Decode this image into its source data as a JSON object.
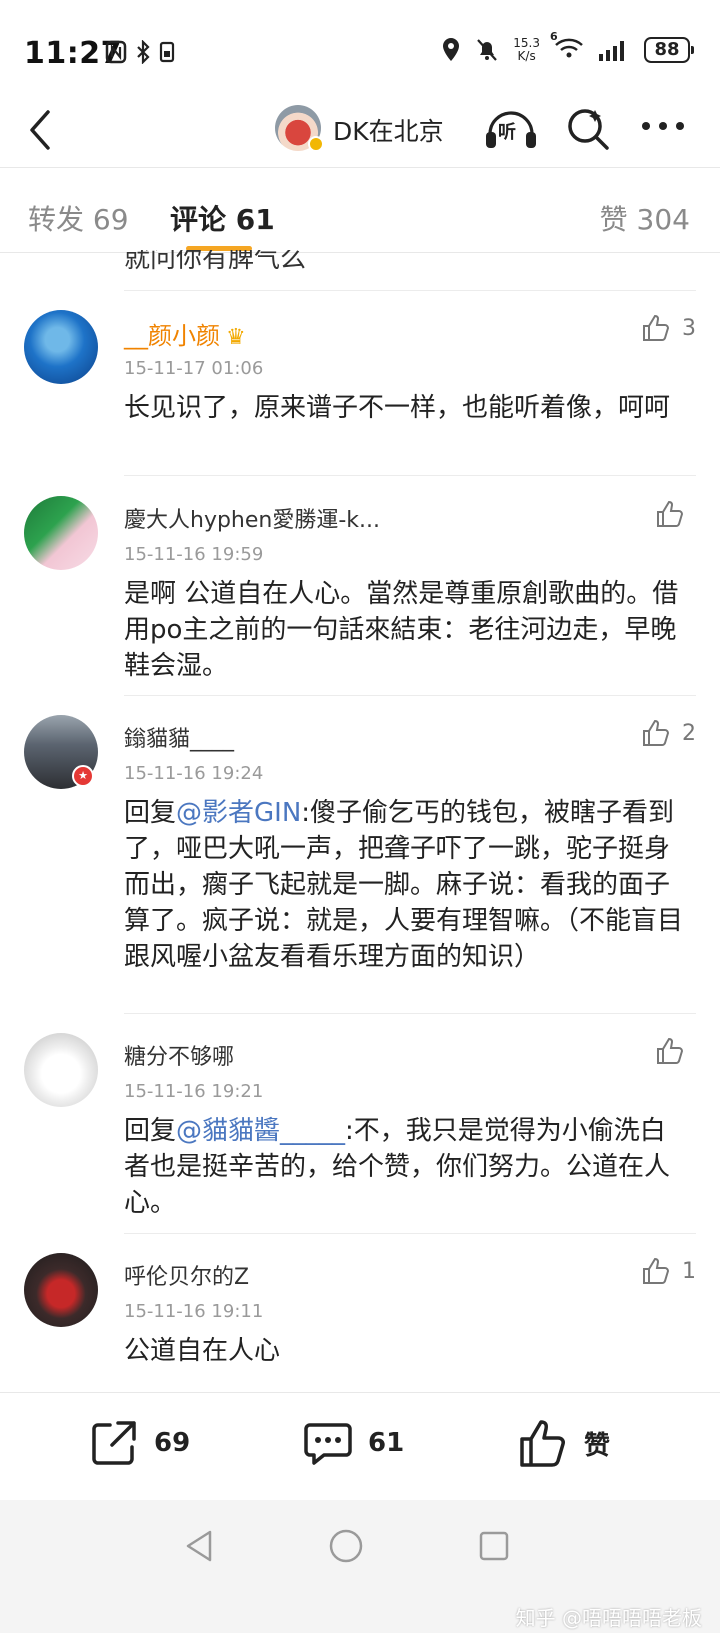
{
  "status_bar": {
    "time": "11:27",
    "net_speed_value": "15.3",
    "net_speed_unit": "K/s",
    "network": "6",
    "battery": "88"
  },
  "nav": {
    "title": "DK在北京",
    "listen_label": "听",
    "icons": [
      "back-arrow-icon",
      "avatar",
      "headphones-icon",
      "search-icon",
      "more-icon"
    ]
  },
  "tabs": {
    "repost": "转发 69",
    "comments": "评论 61",
    "likes": "赞 304"
  },
  "partial_top_text": "就问你有脾气么",
  "comments": [
    {
      "user": "__颜小颜",
      "vip": true,
      "time": "15-11-17 01:06",
      "likes": "3",
      "text": "长见识了，原来谱子不一样，也能听着像，呵呵"
    },
    {
      "user": "慶大人hyphen愛勝運-k...",
      "vip": false,
      "time": "15-11-16 19:59",
      "likes": "",
      "text": "是啊 公道自在人心。當然是尊重原創歌曲的。借用po主之前的一句話來結束：老往河边走，早晚鞋会湿。"
    },
    {
      "user": "鎓貓貓____",
      "vip": false,
      "time": "15-11-16 19:24",
      "likes": "2",
      "reply_prefix": "回复",
      "mention": "@影者GIN",
      "text": ":傻子偷乞丐的钱包，被瞎子看到了，哑巴大吼一声，把聋子吓了一跳，驼子挺身而出，瘸子飞起就是一脚。麻子说：看我的面子算了。疯子说：就是，人要有理智嘛。（不能盲目跟风喔小盆友看看乐理方面的知识）"
    },
    {
      "user": "糖分不够哪",
      "vip": false,
      "time": "15-11-16 19:21",
      "likes": "",
      "reply_prefix": "回复",
      "mention": "@貓貓醬_____",
      "text": ":不，我只是觉得为小偷洗白者也是挺辛苦的，给个赞，你们努力。公道在人心。"
    },
    {
      "user": "呼伦贝尔的Z",
      "vip": false,
      "time": "15-11-16 19:11",
      "likes": "1",
      "text": "公道自在人心"
    }
  ],
  "action_bar": {
    "repost_count": "69",
    "comment_count": "61",
    "like_label": "赞"
  },
  "watermark": "知乎 @唔唔唔唔老板",
  "colors": {
    "accent_orange": "#f5a623",
    "vip_name": "#f08300",
    "mention_blue": "#4b77c0"
  }
}
